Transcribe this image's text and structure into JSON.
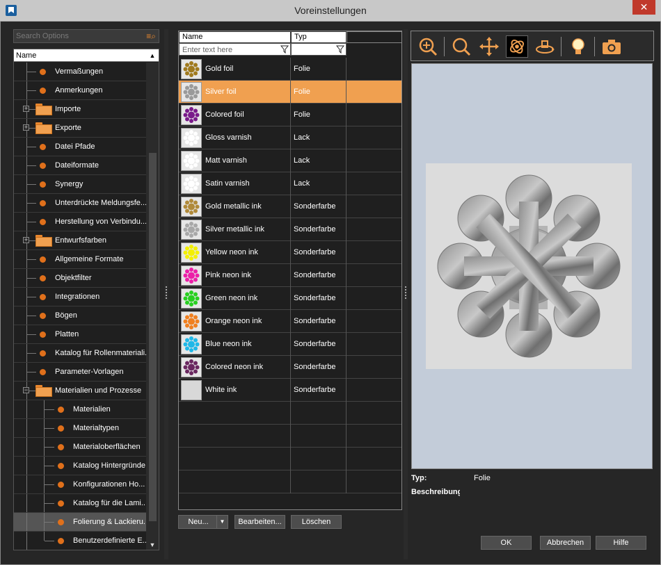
{
  "window": {
    "title": "Voreinstellungen",
    "close": "✕"
  },
  "search": {
    "placeholder": "Search Options"
  },
  "tree": {
    "header": "Name",
    "items": [
      {
        "label": "Vermaßungen",
        "kind": "leaf",
        "level": 0
      },
      {
        "label": "Anmerkungen",
        "kind": "leaf",
        "level": 0
      },
      {
        "label": "Importe",
        "kind": "folder",
        "level": 0,
        "expanded": false
      },
      {
        "label": "Exporte",
        "kind": "folder",
        "level": 0,
        "expanded": false
      },
      {
        "label": "Datei Pfade",
        "kind": "leaf",
        "level": 0
      },
      {
        "label": "Dateiformate",
        "kind": "leaf",
        "level": 0
      },
      {
        "label": "Synergy",
        "kind": "leaf",
        "level": 0
      },
      {
        "label": "Unterdrückte Meldungsfe...",
        "kind": "leaf",
        "level": 0
      },
      {
        "label": "Herstellung von Verbindu...",
        "kind": "leaf",
        "level": 0
      },
      {
        "label": "Entwurfsfarben",
        "kind": "folder",
        "level": 0,
        "expanded": false
      },
      {
        "label": "Allgemeine Formate",
        "kind": "leaf",
        "level": 0
      },
      {
        "label": "Objektfilter",
        "kind": "leaf",
        "level": 0
      },
      {
        "label": "Integrationen",
        "kind": "leaf",
        "level": 0
      },
      {
        "label": "Bögen",
        "kind": "leaf",
        "level": 0
      },
      {
        "label": "Platten",
        "kind": "leaf",
        "level": 0
      },
      {
        "label": "Katalog für Rollenmateriali...",
        "kind": "leaf",
        "level": 0
      },
      {
        "label": "Parameter-Vorlagen",
        "kind": "leaf",
        "level": 0
      },
      {
        "label": "Materialien und Prozesse",
        "kind": "folder",
        "level": 0,
        "expanded": true
      },
      {
        "label": "Materialien",
        "kind": "leaf",
        "level": 1
      },
      {
        "label": "Materialtypen",
        "kind": "leaf",
        "level": 1
      },
      {
        "label": "Materialoberflächen",
        "kind": "leaf",
        "level": 1
      },
      {
        "label": "Katalog Hintergründe",
        "kind": "leaf",
        "level": 1
      },
      {
        "label": "Konfigurationen Ho...",
        "kind": "leaf",
        "level": 1
      },
      {
        "label": "Katalog für die Lami...",
        "kind": "leaf",
        "level": 1
      },
      {
        "label": "Folierung & Lackieru...",
        "kind": "leaf",
        "level": 1,
        "selected": true
      },
      {
        "label": "Benutzerdefinierte E...",
        "kind": "leaf",
        "level": 1
      }
    ]
  },
  "grid": {
    "col_name": "Name",
    "col_type": "Typ",
    "filter_placeholder": "Enter text here",
    "rows": [
      {
        "name": "Gold foil",
        "type": "Folie",
        "color": "#a07a1e"
      },
      {
        "name": "Silver foil",
        "type": "Folie",
        "color": "#9a9a9a",
        "selected": true
      },
      {
        "name": "Colored foil",
        "type": "Folie",
        "color": "#7a1a8a"
      },
      {
        "name": "Gloss varnish",
        "type": "Lack",
        "color": "#ffffff"
      },
      {
        "name": "Matt varnish",
        "type": "Lack",
        "color": "#ffffff"
      },
      {
        "name": "Satin varnish",
        "type": "Lack",
        "color": "#ffffff"
      },
      {
        "name": "Gold metallic ink",
        "type": "Sonderfarbe",
        "color": "#b08a3a"
      },
      {
        "name": "Silver metallic ink",
        "type": "Sonderfarbe",
        "color": "#a8a8a8"
      },
      {
        "name": "Yellow neon ink",
        "type": "Sonderfarbe",
        "color": "#f4f000"
      },
      {
        "name": "Pink neon ink",
        "type": "Sonderfarbe",
        "color": "#ec1fa8"
      },
      {
        "name": "Green neon ink",
        "type": "Sonderfarbe",
        "color": "#28d020"
      },
      {
        "name": "Orange neon ink",
        "type": "Sonderfarbe",
        "color": "#f08020"
      },
      {
        "name": "Blue neon ink",
        "type": "Sonderfarbe",
        "color": "#20b8e8"
      },
      {
        "name": "Colored neon ink",
        "type": "Sonderfarbe",
        "color": "#6a2860"
      },
      {
        "name": "White ink",
        "type": "Sonderfarbe",
        "color": "none"
      }
    ]
  },
  "grid_buttons": {
    "new": "Neu...",
    "edit": "Bearbeiten...",
    "delete": "Löschen"
  },
  "toolbar": {
    "tools": [
      "zoom-in-icon",
      "zoom-icon",
      "pan-icon",
      "rotate-3d-icon",
      "orbit-icon",
      "light-bulb-icon",
      "camera-icon"
    ],
    "active": "rotate-3d-icon"
  },
  "details": {
    "type_label": "Typ:",
    "type_value": "Folie",
    "description_label": "Beschreibung"
  },
  "dialog_buttons": {
    "ok": "OK",
    "cancel": "Abbrechen",
    "help": "Hilfe"
  },
  "colors": {
    "accent": "#f0a050",
    "dot": "#e0701b",
    "preview_bg": "#c3ccd9"
  }
}
